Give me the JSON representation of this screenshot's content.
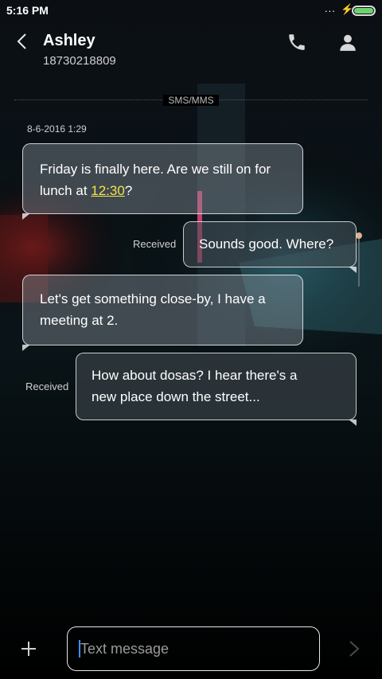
{
  "status_bar": {
    "time": "5:16 PM",
    "dots": "...",
    "charging_icon": "bolt-icon",
    "battery_color": "#6dd36d"
  },
  "header": {
    "contact_name": "Ashley",
    "phone_number": "18730218809",
    "icons": [
      "back-arrow-icon",
      "phone-icon",
      "contact-icon"
    ]
  },
  "thread": {
    "channel_label": "SMS/MMS",
    "date": "8-6-2016 1:29",
    "messages": [
      {
        "direction": "incoming",
        "text_before": "Friday is finally here. Are we still on for\nlunch at ",
        "link": "12:30",
        "text_after": "?"
      },
      {
        "direction": "outgoing",
        "status": "Received",
        "text": "Sounds good. Where?"
      },
      {
        "direction": "incoming",
        "text": "Let's get something close-by, I have a\nmeeting at 2."
      },
      {
        "direction": "outgoing",
        "status": "Received",
        "text": "How about dosas? I hear there's a\nnew place down the street..."
      }
    ]
  },
  "composer": {
    "placeholder": "Text message",
    "value": "",
    "icons": [
      "plus-icon",
      "send-icon"
    ]
  },
  "colors": {
    "background": "#000000",
    "link": "#f2e34c",
    "cursor": "#3c8ff0"
  }
}
